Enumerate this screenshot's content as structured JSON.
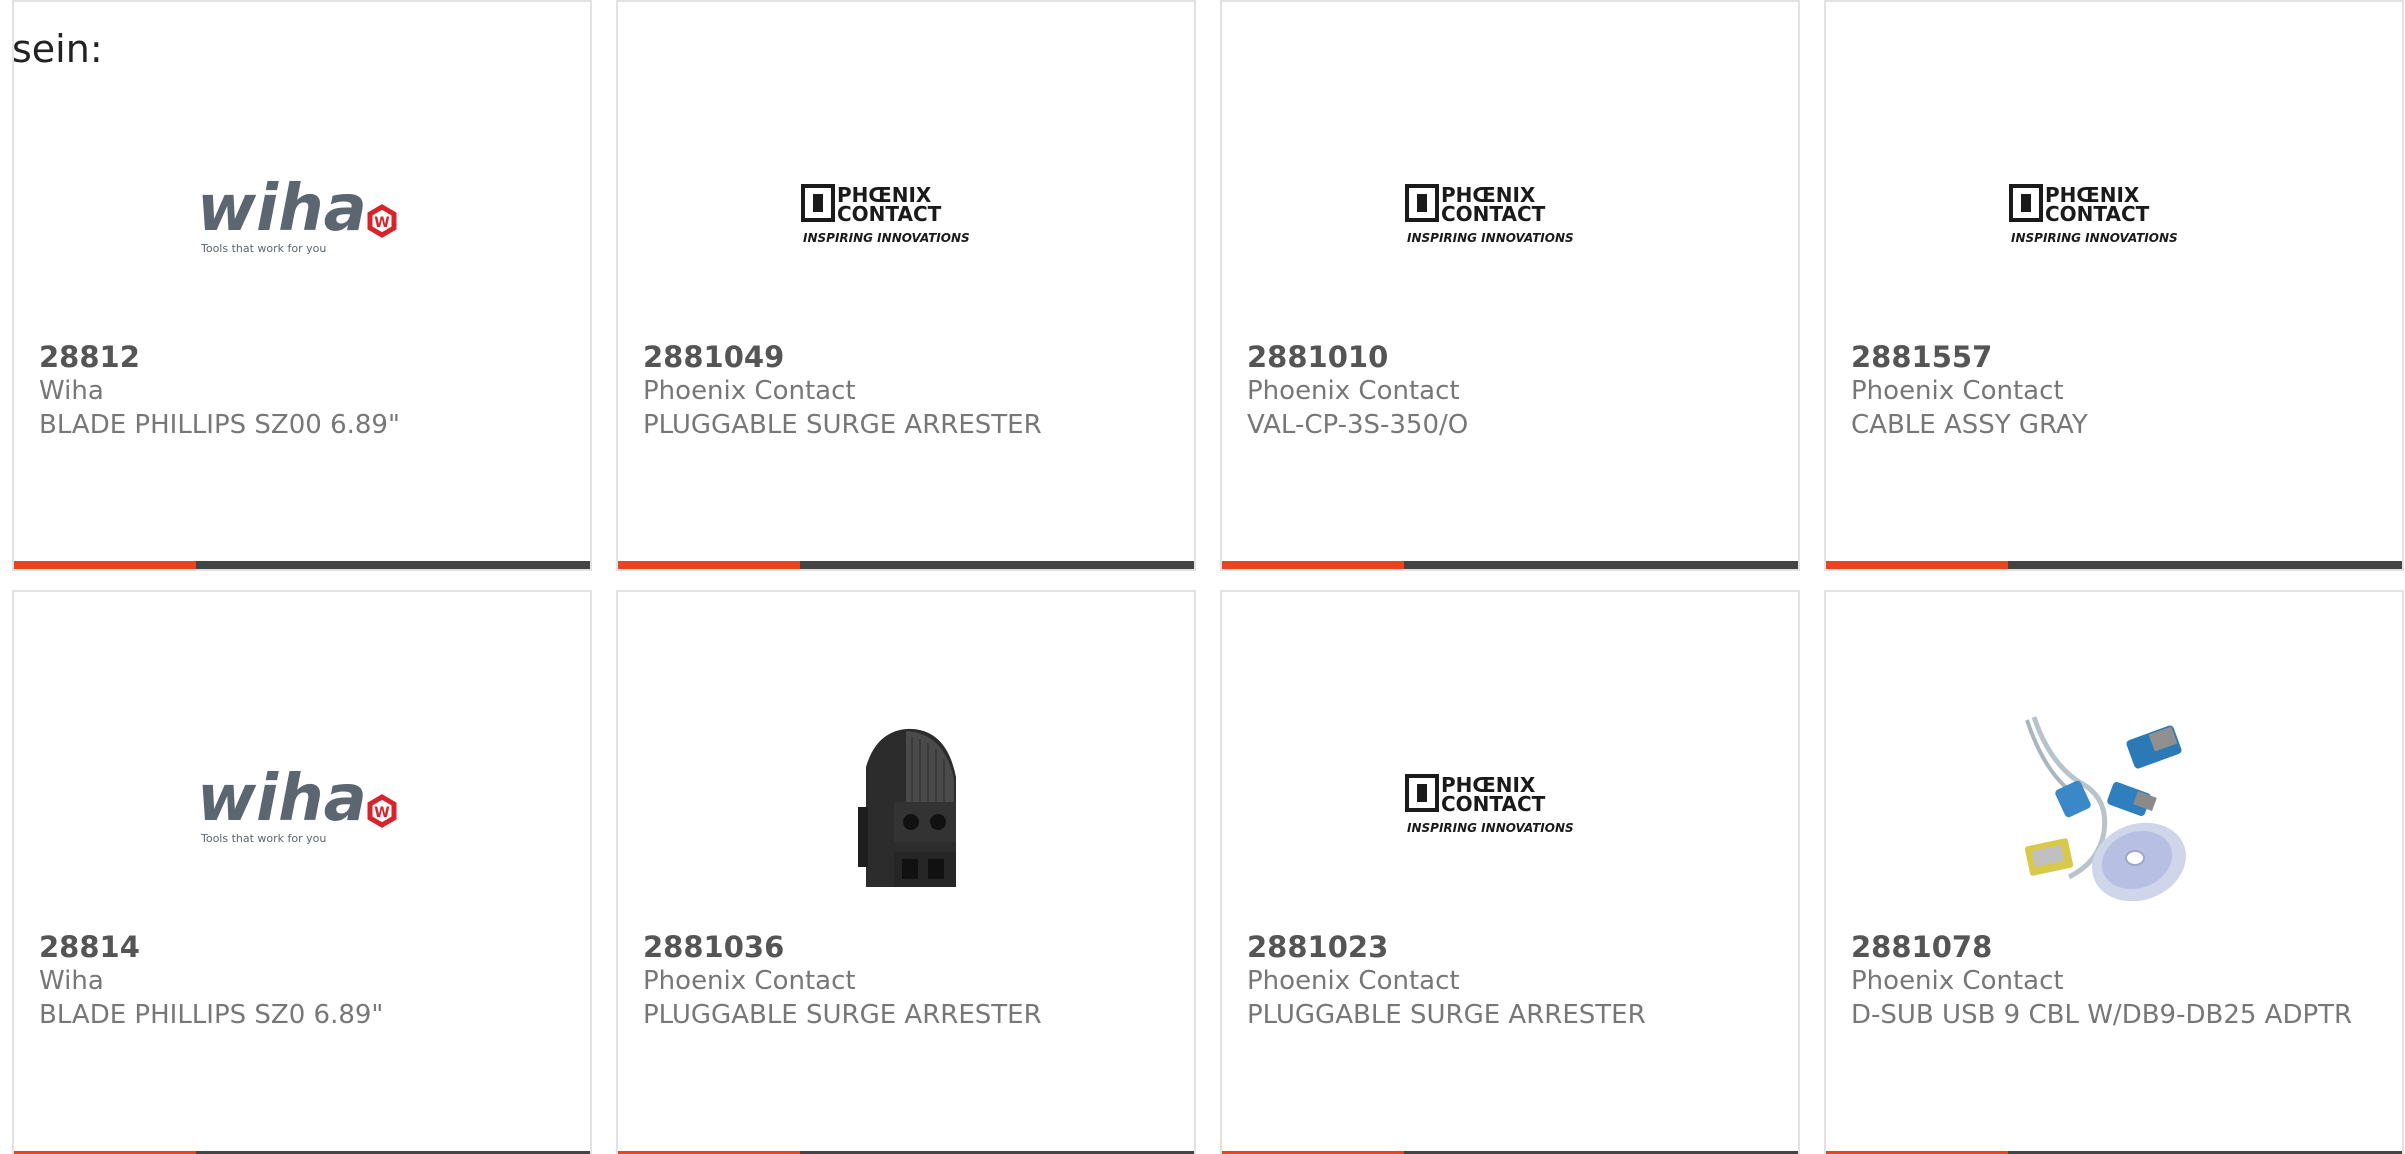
{
  "intro_text": "sein:",
  "colors": {
    "accent": "#e5461f",
    "bar": "#444444",
    "border": "#e2e2e2",
    "text": "#777777"
  },
  "logos": {
    "wiha": {
      "wordmark": "wiha",
      "tagline": "Tools that work for you",
      "badge": "W"
    },
    "phoenix": {
      "line1": "PHŒNIX",
      "line2": "CONTACT",
      "tagline": "INSPIRING INNOVATIONS"
    }
  },
  "products": [
    {
      "part_number": "28812",
      "manufacturer": "Wiha",
      "description": "BLADE PHILLIPS SZ00 6.89\"",
      "image": "wiha-logo"
    },
    {
      "part_number": "2881049",
      "manufacturer": "Phoenix Contact",
      "description": "PLUGGABLE SURGE ARRESTER",
      "image": "phoenix-contact-logo"
    },
    {
      "part_number": "2881010",
      "manufacturer": "Phoenix Contact",
      "description": "VAL-CP-3S-350/O",
      "image": "phoenix-contact-logo"
    },
    {
      "part_number": "2881557",
      "manufacturer": "Phoenix Contact",
      "description": "CABLE ASSY GRAY",
      "image": "phoenix-contact-logo"
    },
    {
      "part_number": "28814",
      "manufacturer": "Wiha",
      "description": "BLADE PHILLIPS SZ0 6.89\"",
      "image": "wiha-logo"
    },
    {
      "part_number": "2881036",
      "manufacturer": "Phoenix Contact",
      "description": "PLUGGABLE SURGE ARRESTER",
      "image": "surge-arrester-photo"
    },
    {
      "part_number": "2881023",
      "manufacturer": "Phoenix Contact",
      "description": "PLUGGABLE SURGE ARRESTER",
      "image": "phoenix-contact-logo"
    },
    {
      "part_number": "2881078",
      "manufacturer": "Phoenix Contact",
      "description": "D-SUB USB 9 CBL W/DB9-DB25 ADPTR",
      "image": "usb-cable-adapter-photo"
    }
  ]
}
